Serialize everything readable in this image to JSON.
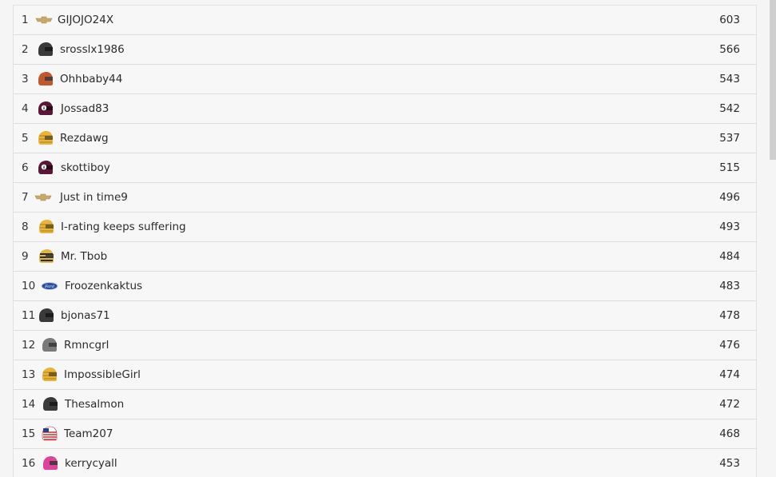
{
  "leaderboard": {
    "rows": [
      {
        "rank": "1",
        "name": "GIJOJO24X",
        "score": "603",
        "icon": "chevrolet-logo-icon"
      },
      {
        "rank": "2",
        "name": "srosslx1986",
        "score": "566",
        "icon": "helmet-black-icon"
      },
      {
        "rank": "3",
        "name": "Ohhbaby44",
        "score": "543",
        "icon": "helmet-orange-icon"
      },
      {
        "rank": "4",
        "name": "Jossad83",
        "score": "542",
        "icon": "helmet-maroon-8ball-icon"
      },
      {
        "rank": "5",
        "name": "Rezdawg",
        "score": "537",
        "icon": "helmet-yellow-icon"
      },
      {
        "rank": "6",
        "name": "skottiboy",
        "score": "515",
        "icon": "helmet-maroon-8ball-icon"
      },
      {
        "rank": "7",
        "name": "Just in time9",
        "score": "496",
        "icon": "chevrolet-logo-icon"
      },
      {
        "rank": "8",
        "name": "I-rating keeps suffering",
        "score": "493",
        "icon": "helmet-yellow-icon"
      },
      {
        "rank": "9",
        "name": "Mr. Tbob",
        "score": "484",
        "icon": "helmet-yellow-striped-icon"
      },
      {
        "rank": "10",
        "name": "Froozenkaktus",
        "score": "483",
        "icon": "ford-logo-icon"
      },
      {
        "rank": "11",
        "name": "bjonas71",
        "score": "478",
        "icon": "helmet-black-icon"
      },
      {
        "rank": "12",
        "name": "Rmncgrl",
        "score": "476",
        "icon": "helmet-gray-icon"
      },
      {
        "rank": "13",
        "name": "ImpossibleGirl",
        "score": "474",
        "icon": "helmet-yellow-icon"
      },
      {
        "rank": "14",
        "name": "Thesalmon",
        "score": "472",
        "icon": "helmet-black-icon"
      },
      {
        "rank": "15",
        "name": "Team207",
        "score": "468",
        "icon": "helmet-usa-flag-icon"
      },
      {
        "rank": "16",
        "name": "kerrycyall",
        "score": "453",
        "icon": "helmet-pink-icon"
      }
    ]
  },
  "colors": {
    "background": "#f5f5f5",
    "row_border": "#dcdcdc",
    "text": "#2b2b2b"
  }
}
